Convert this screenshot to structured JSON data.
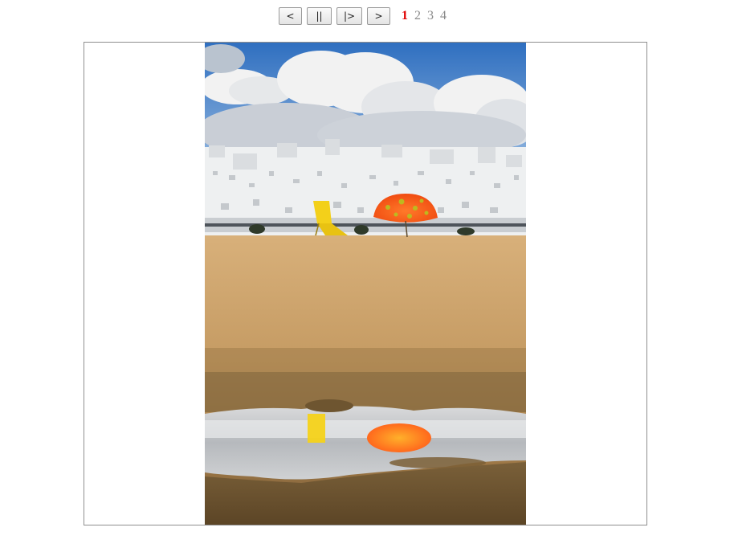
{
  "controls": {
    "prev_label": "<",
    "pause_label": "||",
    "play_label": "|>",
    "next_label": ">"
  },
  "pages": [
    {
      "label": "1",
      "active": true
    },
    {
      "label": "2",
      "active": false
    },
    {
      "label": "3",
      "active": false
    },
    {
      "label": "4",
      "active": false
    }
  ],
  "colors": {
    "active_page": "#e00000",
    "inactive_page": "#8a8a8a"
  }
}
